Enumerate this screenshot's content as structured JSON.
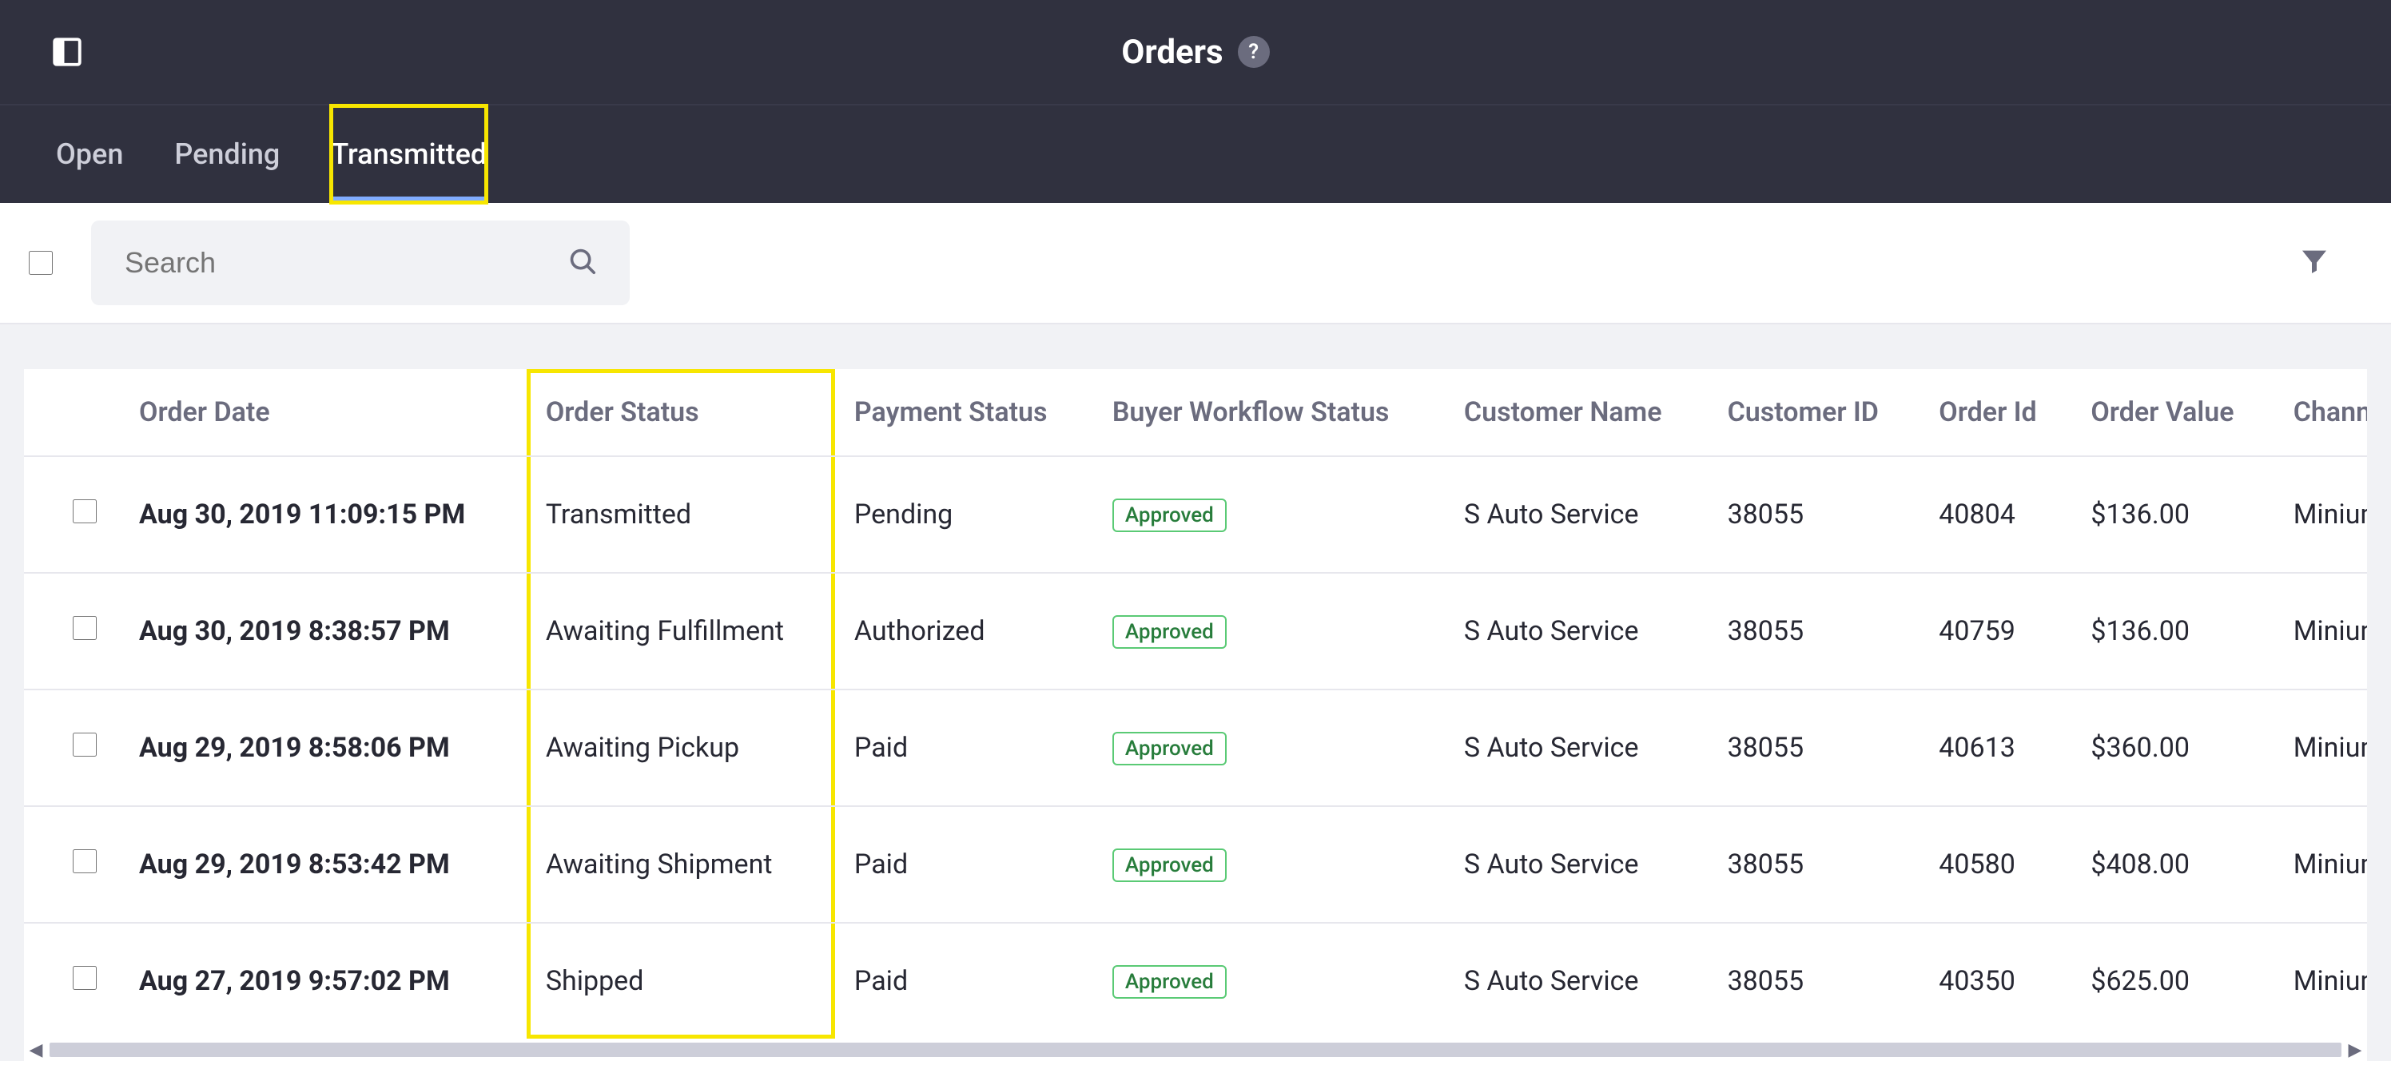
{
  "header": {
    "title": "Orders",
    "help_label": "?"
  },
  "tabs": [
    {
      "label": "Open",
      "active": false,
      "highlight": false
    },
    {
      "label": "Pending",
      "active": false,
      "highlight": false
    },
    {
      "label": "Transmitted",
      "active": true,
      "highlight": true
    }
  ],
  "search": {
    "placeholder": "Search"
  },
  "table": {
    "columns": [
      "Order Date",
      "Order Status",
      "Payment Status",
      "Buyer Workflow Status",
      "Customer Name",
      "Customer ID",
      "Order Id",
      "Order Value",
      "Channel"
    ],
    "highlight_column_index": 1,
    "rows": [
      {
        "order_date": "Aug 30, 2019 11:09:15 PM",
        "order_status": "Transmitted",
        "payment_status": "Pending",
        "buyer_workflow_status": "Approved",
        "customer_name": "S Auto Service",
        "customer_id": "38055",
        "order_id": "40804",
        "order_value": "$136.00",
        "channel": "Minium Full Po"
      },
      {
        "order_date": "Aug 30, 2019 8:38:57 PM",
        "order_status": "Awaiting Fulfillment",
        "payment_status": "Authorized",
        "buyer_workflow_status": "Approved",
        "customer_name": "S Auto Service",
        "customer_id": "38055",
        "order_id": "40759",
        "order_value": "$136.00",
        "channel": "Minium Full Po"
      },
      {
        "order_date": "Aug 29, 2019 8:58:06 PM",
        "order_status": "Awaiting Pickup",
        "payment_status": "Paid",
        "buyer_workflow_status": "Approved",
        "customer_name": "S Auto Service",
        "customer_id": "38055",
        "order_id": "40613",
        "order_value": "$360.00",
        "channel": "Minium Full Po"
      },
      {
        "order_date": "Aug 29, 2019 8:53:42 PM",
        "order_status": "Awaiting Shipment",
        "payment_status": "Paid",
        "buyer_workflow_status": "Approved",
        "customer_name": "S Auto Service",
        "customer_id": "38055",
        "order_id": "40580",
        "order_value": "$408.00",
        "channel": "Minium Full Po"
      },
      {
        "order_date": "Aug 27, 2019 9:57:02 PM",
        "order_status": "Shipped",
        "payment_status": "Paid",
        "buyer_workflow_status": "Approved",
        "customer_name": "S Auto Service",
        "customer_id": "38055",
        "order_id": "40350",
        "order_value": "$625.00",
        "channel": "Minium Full Po"
      }
    ]
  }
}
